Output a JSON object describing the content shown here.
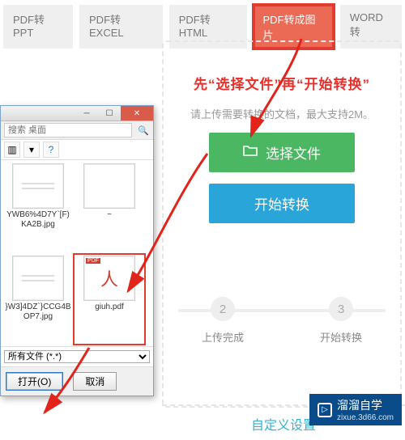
{
  "tabs": {
    "items": [
      {
        "label": "PDF转PPT",
        "active": false
      },
      {
        "label": "PDF转EXCEL",
        "active": false
      },
      {
        "label": "PDF转HTML",
        "active": false
      },
      {
        "label": "PDF转成图片",
        "active": true
      },
      {
        "label": "WORD转",
        "active": false
      }
    ]
  },
  "instruction": "先“选择文件”再“开始转换”",
  "helper_text": "请上传需要转换的文档，最大支持2M。",
  "buttons": {
    "choose_label": "选择文件",
    "start_label": "开始转换"
  },
  "steps": [
    {
      "num": "2",
      "label": "上传完成"
    },
    {
      "num": "3",
      "label": "开始转换"
    }
  ],
  "custom_settings_label": "自定义设置",
  "dialog": {
    "search_placeholder": "搜索 桌面",
    "files": [
      {
        "name": "YWB6%4D7Y`[F)KA2B.jpg",
        "kind": "img"
      },
      {
        "name": "~",
        "kind": "img"
      },
      {
        "name": "}W3]4DZ`}CCG4BOP7.jpg",
        "kind": "img"
      },
      {
        "name": "giuh.pdf",
        "kind": "pdf",
        "selected": true
      }
    ],
    "filter_label": "所有文件 (*.*)",
    "open_label": "打开(O)",
    "cancel_label": "取消"
  },
  "watermark": {
    "brand": "溜溜自学",
    "sub": "zixue.3d66.com"
  }
}
